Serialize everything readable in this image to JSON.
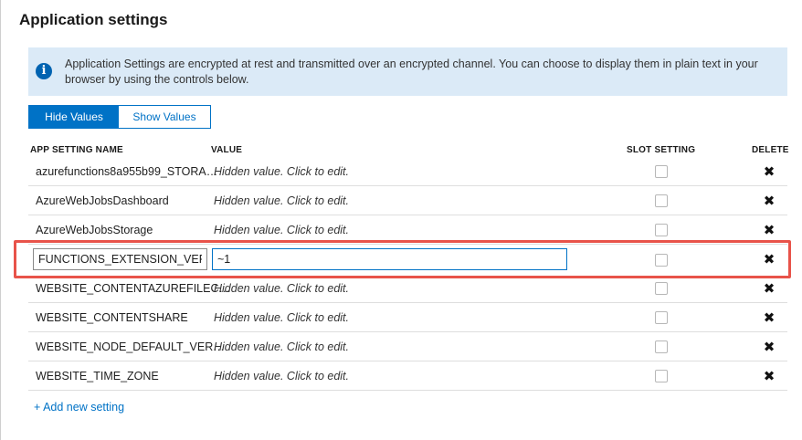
{
  "page": {
    "title": "Application settings"
  },
  "info_banner": {
    "icon": "info-icon",
    "text": "Application Settings are encrypted at rest and transmitted over an encrypted channel. You can choose to display them in plain text in your browser by using the controls below."
  },
  "toggle": {
    "hide_label": "Hide Values",
    "show_label": "Show Values",
    "selected": "Hide Values"
  },
  "table": {
    "columns": {
      "name": "APP SETTING NAME",
      "value": "VALUE",
      "slot": "SLOT SETTING",
      "delete": "DELETE"
    },
    "rows": [
      {
        "name": "azurefunctions8a955b99_STORA…",
        "value": "Hidden value. Click to edit.",
        "slot_setting": false
      },
      {
        "name": "AzureWebJobsDashboard",
        "value": "Hidden value. Click to edit.",
        "slot_setting": false
      },
      {
        "name": "AzureWebJobsStorage",
        "value": "Hidden value. Click to edit.",
        "slot_setting": false
      },
      {
        "name": "FUNCTIONS_EXTENSION_VERSIC",
        "value": "~1",
        "slot_setting": false,
        "editing": true
      },
      {
        "name": "WEBSITE_CONTENTAZUREFILEC…",
        "value": "Hidden value. Click to edit.",
        "slot_setting": false
      },
      {
        "name": "WEBSITE_CONTENTSHARE",
        "value": "Hidden value. Click to edit.",
        "slot_setting": false
      },
      {
        "name": "WEBSITE_NODE_DEFAULT_VER…",
        "value": "Hidden value. Click to edit.",
        "slot_setting": false
      },
      {
        "name": "WEBSITE_TIME_ZONE",
        "value": "Hidden value. Click to edit.",
        "slot_setting": false
      }
    ],
    "delete_glyph": "✖"
  },
  "add_setting_label": "+ Add new setting",
  "colors": {
    "accent": "#0072c6",
    "banner_bg": "#dbeaf7",
    "highlight": "#e8534a"
  }
}
